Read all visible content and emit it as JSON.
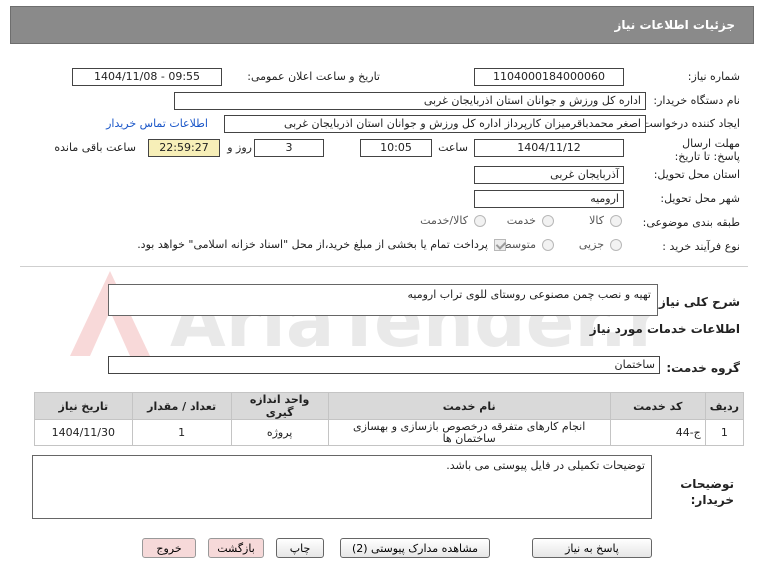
{
  "header": {
    "title": "جزئیات اطلاعات نیاز"
  },
  "form": {
    "need_number_label": "شماره نیاز:",
    "need_number": "1104000184000060",
    "announce_label": "تاریخ و ساعت اعلان عمومی:",
    "announce_value": "1404/11/08 - 09:55",
    "buyer_org_label": "نام دستگاه خریدار:",
    "buyer_org": "اداره کل ورزش و جوانان استان اذربایجان غربی",
    "requester_label": "ایجاد کننده درخواست:",
    "requester": "اصغر محمدباقرمیزان کارپرداز اداره کل ورزش و جوانان استان اذربایجان غربی",
    "contact_link": "اطلاعات تماس خریدار",
    "deadline_label": "مهلت ارسال پاسخ: تا تاریخ:",
    "deadline_date": "1404/11/12",
    "time_label": "ساعت",
    "deadline_time": "10:05",
    "days_value": "3",
    "days_label": "روز و",
    "remaining_time": "22:59:27",
    "remaining_label": "ساعت باقی مانده",
    "delivery_province_label": "استان محل تحویل:",
    "delivery_province": "آذربایجان غربی",
    "delivery_city_label": "شهر محل تحویل:",
    "delivery_city": "ارومیه",
    "category_label": "طبقه بندی موضوعی:",
    "category_options": [
      "کالا",
      "خدمت",
      "کالا/خدمت"
    ],
    "process_label": "نوع فرآیند خرید :",
    "process_options": [
      "جزیی",
      "متوسط"
    ],
    "payment_note": "پرداخت تمام یا بخشی از مبلغ خرید،از محل \"اسناد خزانه اسلامی\" خواهد بود."
  },
  "summary": {
    "label": "شرح کلی نیاز:",
    "value": "تهیه و نصب چمن مصنوعی روستای للوی تراب ارومیه"
  },
  "services": {
    "section_title": "اطلاعات خدمات مورد نیاز",
    "group_label": "گروه خدمت:",
    "group_value": "ساختمان",
    "columns": [
      "ردیف",
      "کد خدمت",
      "نام خدمت",
      "واحد اندازه گیری",
      "تعداد / مقدار",
      "تاریخ نیاز"
    ],
    "rows": [
      [
        "1",
        "ج-44",
        "انجام کارهای متفرقه درخصوص بازسازی و بهسازی ساختمان ها",
        "پروژه",
        "1",
        "1404/11/30"
      ]
    ]
  },
  "notes": {
    "label": "توضیحات خریدار:",
    "value": "توضیحات تکمیلی در فایل پیوستی می باشد."
  },
  "buttons": {
    "reply": "پاسخ به نیاز",
    "docs": "مشاهده مدارک پیوستی (2)",
    "print": "چاپ",
    "back": "بازگشت",
    "exit": "خروج"
  },
  "watermark": {
    "text": "AriaTender.net"
  }
}
